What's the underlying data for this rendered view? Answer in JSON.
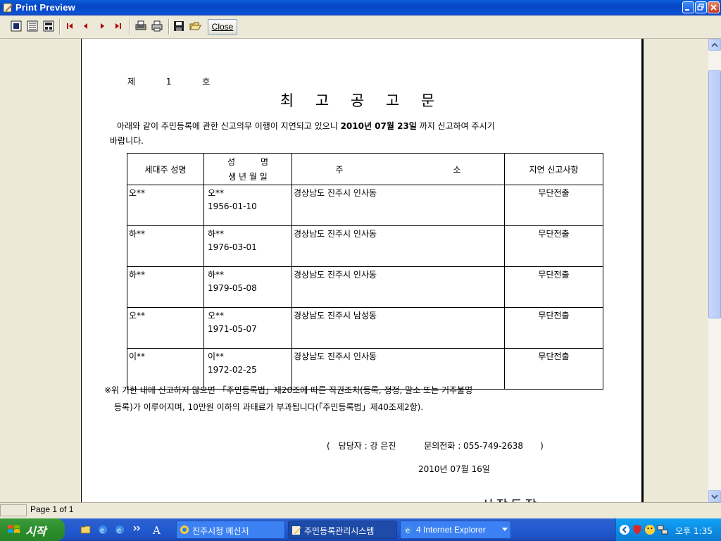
{
  "window": {
    "title": "Print Preview"
  },
  "toolbar": {
    "icons": [
      "one-page-icon",
      "two-page-icon",
      "zoom-icon",
      "first-page-icon",
      "prev-page-icon",
      "next-page-icon",
      "last-page-icon",
      "print-setup-icon",
      "print-icon",
      "save-icon",
      "open-icon"
    ],
    "close_label": "Close"
  },
  "document": {
    "number": "제 1 호",
    "title": "최 고 공 고 문",
    "intro_line1_a": "아래와 같이 주민등록에 관한 신고의무 이행이 지연되고 있으니 ",
    "intro_deadline": "2010년 07월 23일",
    "intro_line1_b": " 까지 신고하여 주시기",
    "intro_line2": "바랍니다.",
    "table": {
      "headers": {
        "col1": "세대주 성명",
        "col2_line1": "성　　　명",
        "col2_line2": "생 년 월 일",
        "col3": "주　　　　　　　　　　　　　소",
        "col4": "지연 신고사항"
      },
      "rows": [
        {
          "householder": "오**",
          "name": "오**",
          "birth": "1956-01-10",
          "address": "경상남도 진주시 인사동",
          "matter": "무단전출"
        },
        {
          "householder": "하**",
          "name": "하**",
          "birth": "1976-03-01",
          "address": "경상남도 진주시 인사동",
          "matter": "무단전출"
        },
        {
          "householder": "하**",
          "name": "하**",
          "birth": "1979-05-08",
          "address": "경상남도 진주시 인사동",
          "matter": "무단전출"
        },
        {
          "householder": "오**",
          "name": "오**",
          "birth": "1971-05-07",
          "address": "경상남도 진주시 남성동",
          "matter": "무단전출"
        },
        {
          "householder": "이**",
          "name": "이**",
          "birth": "1972-02-25",
          "address": "경상남도 진주시 인사동",
          "matter": "무단전출"
        }
      ]
    },
    "note_line1": "※위 기한 내에 신고하지 않으면 「주민등록법」제20조에 따른 직권조치(등록, 정정, 말소 또는 거주불명",
    "note_line2": "등록)가 이루어지며, 10만원 이하의 과태료가 부과됩니다(「주민등록법」제40조제2항).",
    "contact": "(　담당자 : 강 은진　　　 문의전화 : 055-749-2638　　)",
    "date": "2010년 07월 16일",
    "signature_partial": "시장도장"
  },
  "status": {
    "page_indicator": "Page 1 of 1"
  },
  "taskbar": {
    "start_label": "시작",
    "quick_launch_icons": [
      "folder-icon",
      "ie-icon",
      "ie-icon"
    ],
    "tasks": [
      {
        "label": "진주시청 메신저",
        "icon": "messenger-icon",
        "active": false
      },
      {
        "label": "주민등록관리시스템",
        "icon": "app-icon",
        "active": true
      },
      {
        "label": "4 Internet Explorer",
        "icon": "ie-icon",
        "active": false
      }
    ],
    "clock": "오후 1:35"
  }
}
